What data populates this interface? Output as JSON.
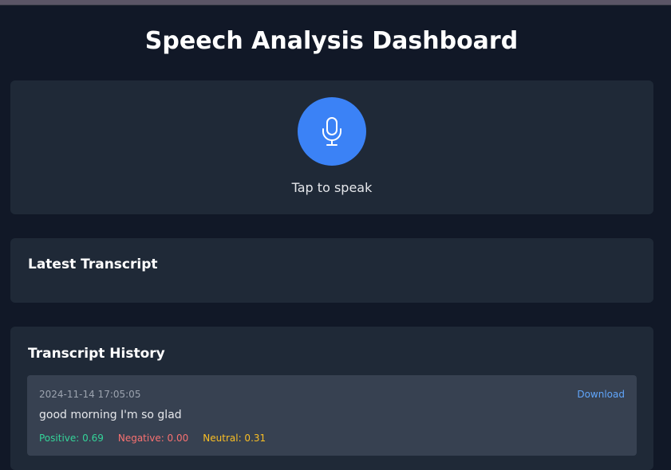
{
  "header": {
    "title": "Speech Analysis Dashboard"
  },
  "recorder": {
    "label": "Tap to speak",
    "icon": "microphone-icon",
    "accent": "#3b82f6"
  },
  "latest": {
    "title": "Latest Transcript"
  },
  "history": {
    "title": "Transcript History",
    "entries": [
      {
        "timestamp": "2024-11-14 17:05:05",
        "download_label": "Download",
        "text": "good morning I'm so glad",
        "positive": "Positive: 0.69",
        "negative": "Negative: 0.00",
        "neutral": "Neutral: 0.31"
      }
    ]
  },
  "colors": {
    "background": "#111827",
    "card": "#1f2937",
    "entry": "#374151",
    "positive": "#34d399",
    "negative": "#f87171",
    "neutral": "#fbbf24",
    "link": "#60a5fa"
  }
}
